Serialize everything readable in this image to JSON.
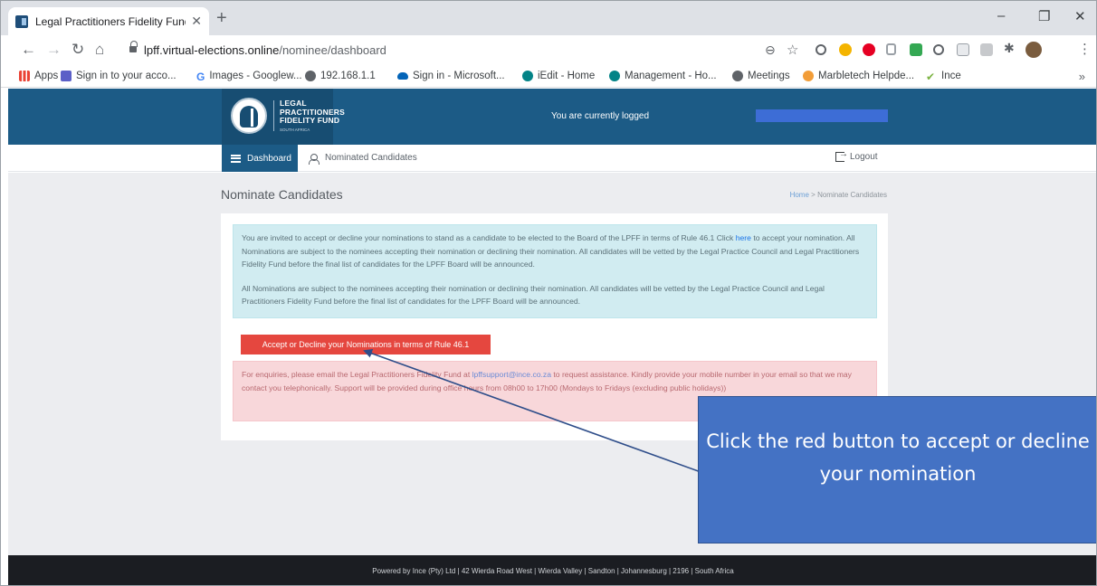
{
  "browser": {
    "tab_title": "Legal Practitioners Fidelity Fund |",
    "tab_close": "✕",
    "new_tab": "+",
    "url_host": "lpff.virtual-elections.online",
    "url_path": "/nominee/dashboard",
    "window_controls": [
      "–",
      "❐",
      "✕"
    ]
  },
  "bookmarks": [
    {
      "label": "Apps",
      "icon": "apps-grid-icon",
      "color": "#ea4335"
    },
    {
      "label": "Sign in to your acco...",
      "icon": "teams-icon",
      "color": "#5b5fc7"
    },
    {
      "label": "Images - Googlew...",
      "icon": "google-icon",
      "color": "#4285f4"
    },
    {
      "label": "192.168.1.1",
      "icon": "globe-icon",
      "color": "#5f6368"
    },
    {
      "label": "Sign in - Microsoft...",
      "icon": "onedrive-icon",
      "color": "#0364b8"
    },
    {
      "label": "iEdit - Home",
      "icon": "sharepoint-icon",
      "color": "#038387"
    },
    {
      "label": "Management - Ho...",
      "icon": "sharepoint-icon",
      "color": "#038387"
    },
    {
      "label": "Meetings",
      "icon": "globe-icon",
      "color": "#5f6368"
    },
    {
      "label": "Marbletech Helpde...",
      "icon": "helpdesk-icon",
      "color": "#f29d38"
    },
    {
      "label": "Ince",
      "icon": "check-icon",
      "color": "#7cb342"
    }
  ],
  "bookmarks_more": "»",
  "header": {
    "logo_lines": [
      "LEGAL",
      "PRACTITIONERS",
      "FIDELITY FUND"
    ],
    "logo_sub": "SOUTH AFRICA",
    "logged_text": "You are currently logged"
  },
  "nav": {
    "dashboard": "Dashboard",
    "nominated": "Nominated Candidates",
    "logout": "Logout"
  },
  "page": {
    "title": "Nominate Candidates",
    "breadcrumb_home": "Home",
    "breadcrumb_sep": ">",
    "breadcrumb_current": "Nominate Candidates"
  },
  "info": {
    "p1_before": "You are invited to accept or decline your nominations to stand as a candidate to be elected to the Board of the LPFF in terms of Rule 46.1 Click",
    "p1_link": "here",
    "p1_after": "to accept your nomination. All Nominations are subject to the nominees accepting their nomination or declining their nomination. All candidates will be vetted by the Legal Practice Council and Legal Practitioners Fidelity Fund before the final list of candidates for the LPFF Board will be announced.",
    "p2": "All Nominations are subject to the nominees accepting their nomination or declining their nomination. All candidates will be vetted by the Legal Practice Council and Legal Practitioners Fidelity Fund before the final list of candidates for the LPFF Board will be announced."
  },
  "accept_button": "Accept or Decline your Nominations in terms of Rule 46.1",
  "enquiry": {
    "before": "For enquiries, please email the Legal Practitioners Fidelity Fund at",
    "email": "lpffsupport@ince.co.za",
    "after": "to request assistance. Kindly provide your mobile number in your email so that we may contact you telephonically. Support will be provided during office hours from 08h00 to 17h00 (Mondays to Fridays (excluding public holidays))"
  },
  "callout": "Click the red button to accept or decline your nomination",
  "footer": "Powered by Ince (Pty) Ltd | 42 Wierda Road West | Wierda Valley | Sandton | Johannesburg | 2196 | South Africa",
  "colors": {
    "header_blue": "#1c5b86",
    "accept_red": "#e5473f",
    "callout_blue": "#4472c4",
    "footer_dark": "#1b1d22"
  }
}
